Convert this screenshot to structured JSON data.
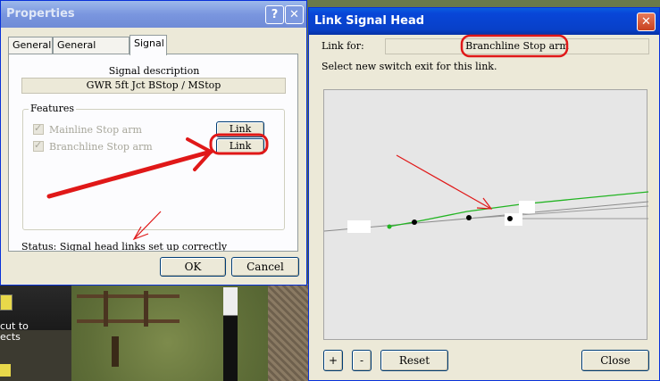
{
  "background": {
    "hint_text": "cut to\nects"
  },
  "properties": {
    "title": "Properties",
    "tabs": [
      "General",
      "General (cont.)",
      "Signal"
    ],
    "signal_description_label": "Signal description",
    "signal_description_value": "GWR 5ft Jct BStop / MStop",
    "features_label": "Features",
    "features": [
      {
        "label": "Mainline Stop arm",
        "checked": true,
        "enabled": false,
        "link_label": "Link"
      },
      {
        "label": "Branchline Stop arm",
        "checked": true,
        "enabled": false,
        "link_label": "Link"
      }
    ],
    "status_text": "Status: Signal head links set up correctly",
    "ok_label": "OK",
    "cancel_label": "Cancel"
  },
  "link_dialog": {
    "title": "Link Signal Head",
    "link_for_label": "Link for:",
    "link_for_value": "Branchline Stop arm",
    "instruction": "Select new switch exit for this link.",
    "zoom_in_label": "+",
    "zoom_out_label": "-",
    "reset_label": "Reset",
    "close_label": "Close"
  },
  "colors": {
    "annotation_red": "#e01818",
    "track_green": "#22b422",
    "track_gray": "#8a8a8a",
    "title_active": "#0846d8"
  }
}
